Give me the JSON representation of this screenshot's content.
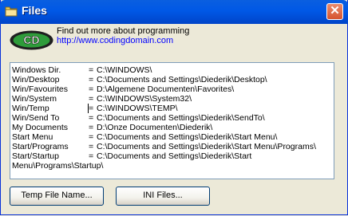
{
  "window": {
    "title": "Files",
    "close_glyph": "✕",
    "icon": "folder-icon"
  },
  "header": {
    "logo_text": "CD",
    "promo_text": "Find out more about programming",
    "promo_link": "http://www.codingdomain.com"
  },
  "entries": [
    {
      "key": "Windows Dir.",
      "value": "C:\\WINDOWS\\"
    },
    {
      "key": "Win/Desktop",
      "value": "C:\\Documents and Settings\\Diederik\\Desktop\\"
    },
    {
      "key": "Win/Favourites",
      "value": "D:\\Algemene Documenten\\Favorites\\"
    },
    {
      "key": "Win/System",
      "value": "C:\\WINDOWS\\System32\\"
    },
    {
      "key": "Win/Temp",
      "value": "C:\\WINDOWS\\TEMP\\"
    },
    {
      "key": "Win/Send To",
      "value": "C:\\Documents and Settings\\Diederik\\SendTo\\"
    },
    {
      "key": "My Documents",
      "value": "D:\\Onze Documenten\\Diederik\\"
    },
    {
      "key": "Start Menu",
      "value": "C:\\Documents and Settings\\Diederik\\Start Menu\\"
    },
    {
      "key": "Start/Programs",
      "value": "C:\\Documents and Settings\\Diederik\\Start Menu\\Programs\\"
    },
    {
      "key": "Start/Startup",
      "value": "C:\\Documents and Settings\\Diederik\\Start"
    }
  ],
  "continuation": "Menu\\Programs\\Startup\\",
  "equals": "=",
  "buttons": {
    "temp_file": "Temp File Name...",
    "ini_files": "INI Files..."
  },
  "colors": {
    "titlebar": "#0058e6",
    "link": "#0000ff",
    "logo_green": "#2e9c3a",
    "logo_ring": "#1f1f1f"
  }
}
